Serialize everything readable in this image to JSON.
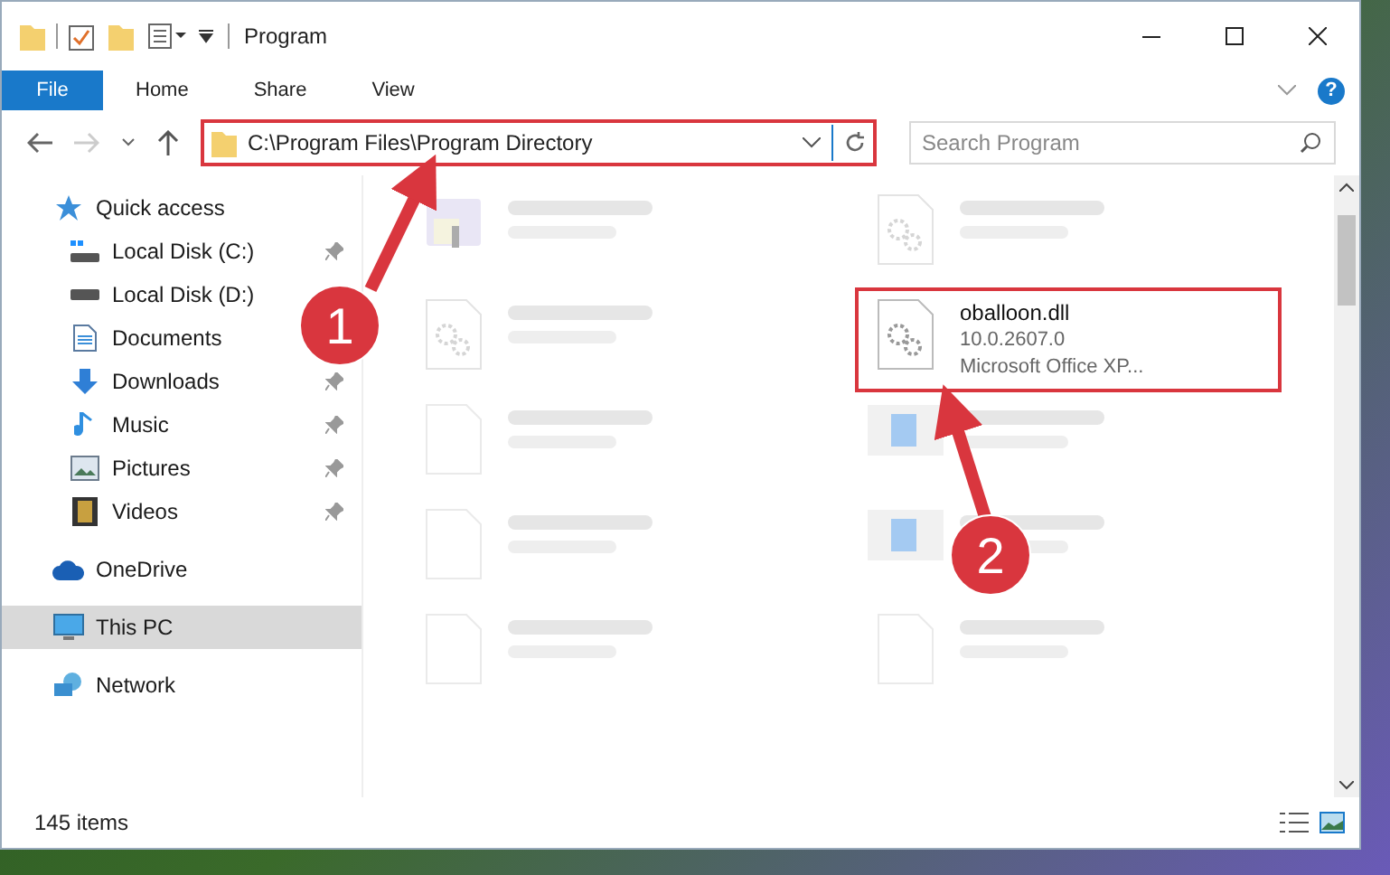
{
  "window": {
    "title": "Program"
  },
  "ribbon": {
    "tabs": [
      {
        "label": "File",
        "kind": "file",
        "selected": false
      },
      {
        "label": "Home",
        "kind": "tab",
        "selected": false
      },
      {
        "label": "Share",
        "kind": "tab",
        "selected": false
      },
      {
        "label": "View",
        "kind": "tab",
        "selected": false
      }
    ],
    "help": "?"
  },
  "address_bar": {
    "path": "C:\\Program Files\\Program Directory",
    "highlighted": true
  },
  "search": {
    "placeholder": "Search Program"
  },
  "navigation": [
    {
      "label": "Quick access",
      "selected": false,
      "children": [
        {
          "label": "Local Disk (C:)",
          "pinned": true,
          "selected": false
        },
        {
          "label": "Local Disk (D:)",
          "pinned": false,
          "selected": false
        },
        {
          "label": "Documents",
          "pinned": false,
          "selected": false
        },
        {
          "label": "Downloads",
          "pinned": true,
          "selected": false
        },
        {
          "label": "Music",
          "pinned": true,
          "selected": false
        },
        {
          "label": "Pictures",
          "pinned": true,
          "selected": false
        },
        {
          "label": "Videos",
          "pinned": true,
          "selected": false
        }
      ]
    },
    {
      "label": "OneDrive",
      "selected": false
    },
    {
      "label": "This PC",
      "selected": true
    },
    {
      "label": "Network",
      "selected": false
    }
  ],
  "files": [
    {
      "kind": "exe",
      "blurred": true,
      "highlighted": false
    },
    {
      "kind": "dll",
      "blurred": true,
      "highlighted": false
    },
    {
      "kind": "dll",
      "blurred": true,
      "highlighted": false
    },
    {
      "kind": "dll",
      "name": "oballoon.dll",
      "lines": [
        "10.0.2607.0",
        "Microsoft Office XP..."
      ],
      "blurred": false,
      "highlighted": true
    },
    {
      "kind": "blank",
      "blurred": true,
      "highlighted": false
    },
    {
      "kind": "app",
      "blurred": true,
      "highlighted": false
    },
    {
      "kind": "blank",
      "blurred": true,
      "highlighted": false
    },
    {
      "kind": "app",
      "blurred": true,
      "highlighted": false
    },
    {
      "kind": "blank",
      "blurred": true,
      "highlighted": false
    },
    {
      "kind": "blank",
      "blurred": true,
      "highlighted": false
    }
  ],
  "status_bar": {
    "item_count": "145 items"
  },
  "callouts": [
    {
      "number": "1"
    },
    {
      "number": "2"
    }
  ]
}
